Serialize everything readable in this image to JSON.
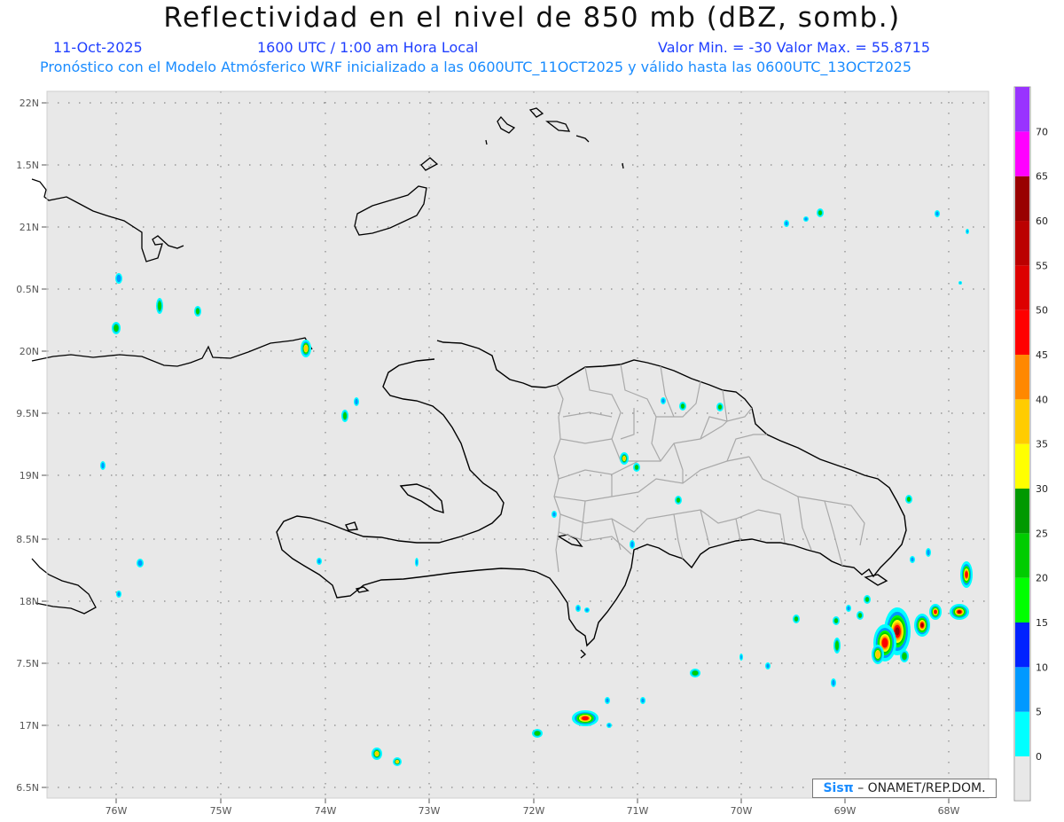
{
  "header": {
    "title": "Reflectividad en el nivel de 850 mb (dBZ, somb.)",
    "date": "11-Oct-2025",
    "time": "1600 UTC / 1:00 am Hora Local",
    "minmax": "Valor Min. = -30  Valor Max. = 55.8715",
    "forecast": "Pronóstico con el Modelo Atmósferico WRF inicializado a las 0600UTC_11OCT2025 y válido hasta las  0600UTC_13OCT2025"
  },
  "axes": {
    "lat_labels": [
      "22N",
      "1.5N",
      "21N",
      "0.5N",
      "20N",
      "9.5N",
      "19N",
      "8.5N",
      "18N",
      "7.5N",
      "17N",
      "6.5N"
    ],
    "lon_labels": [
      "76W",
      "75W",
      "74W",
      "73W",
      "72W",
      "71W",
      "70W",
      "69W",
      "68W"
    ],
    "lat_range": [
      16.5,
      22.0
    ],
    "lon_range": [
      -76.65,
      -67.6
    ],
    "grid": true
  },
  "colorbar": {
    "labels": [
      "0",
      "5",
      "10",
      "15",
      "20",
      "25",
      "30",
      "35",
      "40",
      "45",
      "50",
      "55",
      "60",
      "65",
      "70"
    ],
    "colors": [
      "#00ffff",
      "#0099ff",
      "#0022ff",
      "#0000cc",
      "#00ff00",
      "#00cc00",
      "#009900",
      "#ffff00",
      "#ffcc00",
      "#ff8800",
      "#ff0000",
      "#dd0000",
      "#bb0000",
      "#990000",
      "#ff00ff",
      "#9933ff"
    ]
  },
  "credit": {
    "logo": "Sisπ",
    "text": " – ONAMET/REP.DOM."
  },
  "colors": {
    "background": "#e8e8e8",
    "coast": "#000000",
    "provinces": "#a9a9a9",
    "grid": "#888888"
  }
}
